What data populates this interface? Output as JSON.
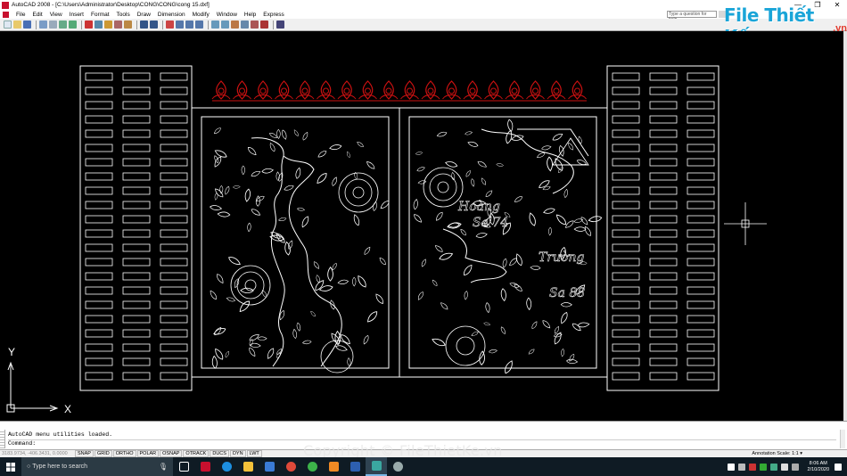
{
  "window": {
    "title": "AutoCAD 2008 - [C:\\Users\\Administrator\\Desktop\\CONG\\CONG\\cong 15.dxf]",
    "controls": [
      "—",
      "❐",
      "✕"
    ]
  },
  "menubar": {
    "items": [
      "File",
      "Edit",
      "View",
      "Insert",
      "Format",
      "Tools",
      "Draw",
      "Dimension",
      "Modify",
      "Window",
      "Help",
      "Express"
    ],
    "help_search_placeholder": "Type a question for help"
  },
  "logo": {
    "mark": "File Thiết Kế",
    "suffix": ".vn"
  },
  "drawing": {
    "background": "#000000",
    "text_hoang_1": "Hoàng",
    "text_hoang_2": "Sa 74",
    "text_truong_1": "Trường",
    "text_truong_2": "Sa 88",
    "ucs_y": "Y",
    "ucs_x": "X"
  },
  "command": {
    "history": "AutoCAD menu utilities loaded.",
    "prompt": "Command:"
  },
  "status": {
    "coords": "3183.9734, -406.3431, 0.0000",
    "toggles": [
      "SNAP",
      "GRID",
      "ORTHO",
      "POLAR",
      "OSNAP",
      "OTRACK",
      "DUCS",
      "DYN",
      "LWT"
    ],
    "annotation_scale": "Annotation Scale: 1:1 ▾"
  },
  "taskbar": {
    "search_placeholder": "Type here to search",
    "time": "8:06 AM",
    "date": "2/10/2020"
  },
  "watermark": "Copyright © FileThietKe.vn",
  "colors": {
    "lines": "#ffffff",
    "ornament": "#cc1111",
    "crosshair": "#ffffff"
  }
}
